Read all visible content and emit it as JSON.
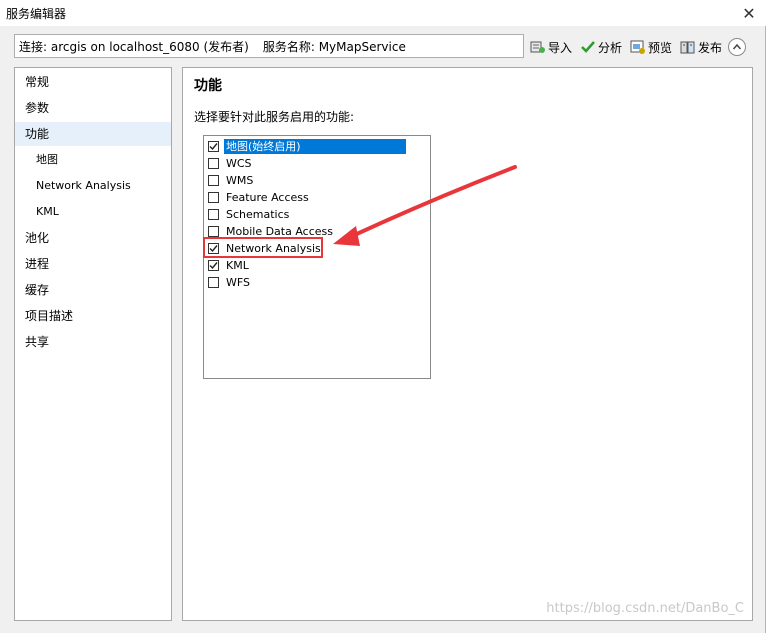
{
  "window": {
    "title": "服务编辑器"
  },
  "info_bar": {
    "connection": "连接: arcgis on localhost_6080 (发布者)",
    "service_name": "服务名称: MyMapService"
  },
  "toolbar": {
    "import_label": "导入",
    "analyze_label": "分析",
    "preview_label": "预览",
    "publish_label": "发布"
  },
  "sidebar": {
    "items": [
      {
        "label": "常规"
      },
      {
        "label": "参数"
      },
      {
        "label": "功能",
        "selected": true
      },
      {
        "label": "地图"
      },
      {
        "label": "Network Analysis"
      },
      {
        "label": "KML"
      },
      {
        "label": "池化"
      },
      {
        "label": "进程"
      },
      {
        "label": "缓存"
      },
      {
        "label": "项目描述"
      },
      {
        "label": "共享"
      }
    ]
  },
  "main": {
    "heading": "功能",
    "instruction": "选择要针对此服务启用的功能:",
    "capabilities": [
      {
        "label": "地图(始终启用)",
        "checked": true
      },
      {
        "label": "WCS",
        "checked": false
      },
      {
        "label": "WMS",
        "checked": false
      },
      {
        "label": "Feature Access",
        "checked": false
      },
      {
        "label": "Schematics",
        "checked": false
      },
      {
        "label": "Mobile Data Access",
        "checked": false
      },
      {
        "label": "Network Analysis",
        "checked": true
      },
      {
        "label": "KML",
        "checked": true
      },
      {
        "label": "WFS",
        "checked": false
      }
    ]
  },
  "watermark": "https://blog.csdn.net/DanBo_C",
  "colors": {
    "selection": "#0078d7",
    "sidebar_selected": "#e5f0fb",
    "annotation_red": "#e8363b"
  }
}
